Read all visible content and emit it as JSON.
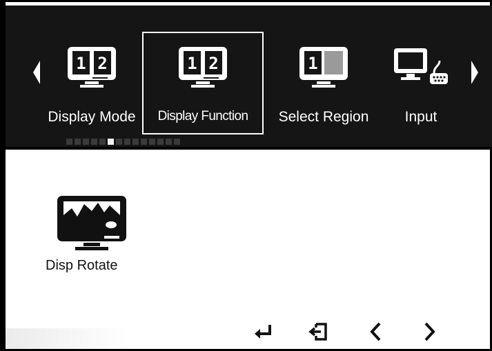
{
  "menu": {
    "items": [
      {
        "label": "Display Mode",
        "icon": "dual-monitor-12-icon"
      },
      {
        "label": "Display Function",
        "icon": "dual-monitor-12-icon",
        "selected": true
      },
      {
        "label": "Select Region",
        "icon": "region-monitor-icon"
      },
      {
        "label": "Input",
        "icon": "monitor-input-icon"
      }
    ],
    "icon_digits": {
      "left": "1",
      "right": "2",
      "region": "1"
    },
    "pagination": {
      "total": 14,
      "active_index": 5
    }
  },
  "content": {
    "items": [
      {
        "label": "Disp Rotate",
        "icon": "monitor-landscape-icon"
      }
    ]
  },
  "controls": [
    {
      "name": "enter-button",
      "icon": "enter-return-icon"
    },
    {
      "name": "exit-button",
      "icon": "exit-icon"
    },
    {
      "name": "previous-button",
      "icon": "chevron-left-icon"
    },
    {
      "name": "next-button",
      "icon": "chevron-right-icon"
    }
  ],
  "colors": {
    "bar_background": "#151515",
    "content_background": "#ffffff",
    "text_on_bar": "#ffffff"
  }
}
